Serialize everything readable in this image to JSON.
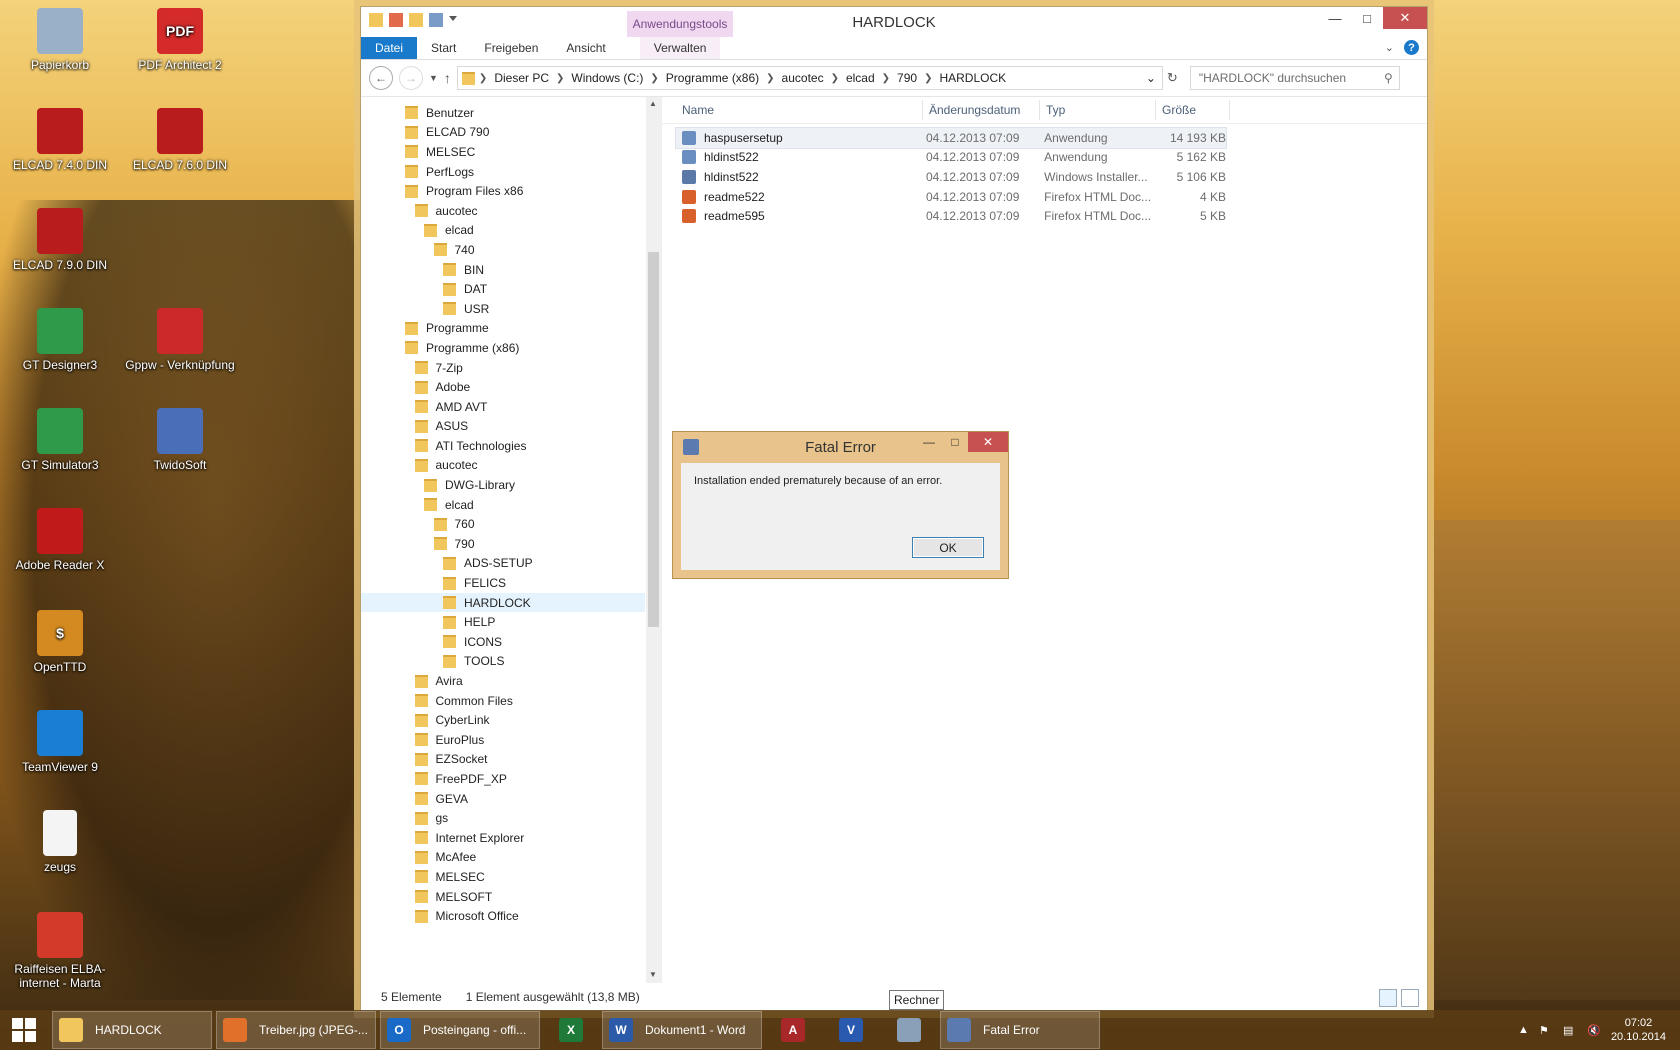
{
  "desktop": {
    "icons": [
      {
        "label": "Papierkorb",
        "icon": "recycle-bin-icon",
        "color": "#9ab0c8"
      },
      {
        "label": "PDF Architect 2",
        "icon": "pdf-icon",
        "color": "#d42a2a",
        "text": "PDF"
      },
      {
        "label": "ELCAD 7.4.0 DIN",
        "icon": "elcad-icon",
        "color": "#b81c1c"
      },
      {
        "label": "ELCAD 7.6.0 DIN",
        "icon": "elcad-icon",
        "color": "#b81c1c"
      },
      {
        "label": "ELCAD 7.9.0 DIN",
        "icon": "elcad-icon",
        "color": "#b81c1c"
      },
      {
        "label": "GT Designer3",
        "icon": "gt-icon",
        "color": "#2f9a4a"
      },
      {
        "label": "Gppw - Verknüpfung",
        "icon": "gppw-icon",
        "color": "#cc2a2a"
      },
      {
        "label": "GT Simulator3",
        "icon": "gt-icon",
        "color": "#2f9a4a"
      },
      {
        "label": "TwidoSoft",
        "icon": "twido-icon",
        "color": "#4a6fb8"
      },
      {
        "label": "Adobe Reader X",
        "icon": "adobe-reader-icon",
        "color": "#c01a1a"
      },
      {
        "label": "OpenTTD",
        "icon": "openttd-icon",
        "color": "#d48a20",
        "text": "$"
      },
      {
        "label": "TeamViewer 9",
        "icon": "teamviewer-icon",
        "color": "#1a7fd4"
      },
      {
        "label": "zeugs",
        "icon": "text-file-icon",
        "color": "#f4f4f4"
      },
      {
        "label": "Raiffeisen ELBA-internet - Marta",
        "icon": "raiffeisen-icon",
        "color": "#d43a2a"
      }
    ]
  },
  "explorer": {
    "title": "HARDLOCK",
    "context_tab": "Anwendungstools",
    "ribbon_tabs": [
      "Datei",
      "Start",
      "Freigeben",
      "Ansicht",
      "Verwalten"
    ],
    "help": "?",
    "breadcrumb": [
      "Dieser PC",
      "Windows (C:)",
      "Programme (x86)",
      "aucotec",
      "elcad",
      "790",
      "HARDLOCK"
    ],
    "search_placeholder": "\"HARDLOCK\" durchsuchen",
    "tree": [
      {
        "label": "Benutzer",
        "indent": 0
      },
      {
        "label": "ELCAD 790",
        "indent": 0
      },
      {
        "label": "MELSEC",
        "indent": 0
      },
      {
        "label": "PerfLogs",
        "indent": 0
      },
      {
        "label": "Program Files x86",
        "indent": 0
      },
      {
        "label": "aucotec",
        "indent": 1
      },
      {
        "label": "elcad",
        "indent": 2
      },
      {
        "label": "740",
        "indent": 3
      },
      {
        "label": "BIN",
        "indent": 4
      },
      {
        "label": "DAT",
        "indent": 4
      },
      {
        "label": "USR",
        "indent": 4
      },
      {
        "label": "Programme",
        "indent": 0
      },
      {
        "label": "Programme (x86)",
        "indent": 0
      },
      {
        "label": "7-Zip",
        "indent": 1
      },
      {
        "label": "Adobe",
        "indent": 1
      },
      {
        "label": "AMD AVT",
        "indent": 1
      },
      {
        "label": "ASUS",
        "indent": 1
      },
      {
        "label": "ATI Technologies",
        "indent": 1
      },
      {
        "label": "aucotec",
        "indent": 1
      },
      {
        "label": "DWG-Library",
        "indent": 2
      },
      {
        "label": "elcad",
        "indent": 2
      },
      {
        "label": "760",
        "indent": 3
      },
      {
        "label": "790",
        "indent": 3
      },
      {
        "label": "ADS-SETUP",
        "indent": 4
      },
      {
        "label": "FELICS",
        "indent": 4
      },
      {
        "label": "HARDLOCK",
        "indent": 4,
        "selected": true
      },
      {
        "label": "HELP",
        "indent": 4
      },
      {
        "label": "ICONS",
        "indent": 4
      },
      {
        "label": "TOOLS",
        "indent": 4
      },
      {
        "label": "Avira",
        "indent": 1
      },
      {
        "label": "Common Files",
        "indent": 1
      },
      {
        "label": "CyberLink",
        "indent": 1
      },
      {
        "label": "EuroPlus",
        "indent": 1
      },
      {
        "label": "EZSocket",
        "indent": 1
      },
      {
        "label": "FreePDF_XP",
        "indent": 1
      },
      {
        "label": "GEVA",
        "indent": 1
      },
      {
        "label": "gs",
        "indent": 1
      },
      {
        "label": "Internet Explorer",
        "indent": 1
      },
      {
        "label": "McAfee",
        "indent": 1
      },
      {
        "label": "MELSEC",
        "indent": 1
      },
      {
        "label": "MELSOFT",
        "indent": 1
      },
      {
        "label": "Microsoft Office",
        "indent": 1
      }
    ],
    "columns": [
      "Name",
      "Änderungsdatum",
      "Typ",
      "Größe"
    ],
    "files": [
      {
        "name": "haspusersetup",
        "date": "04.12.2013 07:09",
        "type": "Anwendung",
        "size": "14 193 KB",
        "icon": "installer-icon",
        "color": "#6a8ec0",
        "selected": true
      },
      {
        "name": "hldinst522",
        "date": "04.12.2013 07:09",
        "type": "Anwendung",
        "size": "5 162 KB",
        "icon": "installer-icon",
        "color": "#6a8ec0"
      },
      {
        "name": "hldinst522",
        "date": "04.12.2013 07:09",
        "type": "Windows Installer...",
        "size": "5 106 KB",
        "icon": "msi-icon",
        "color": "#5a78a8"
      },
      {
        "name": "readme522",
        "date": "04.12.2013 07:09",
        "type": "Firefox HTML Doc...",
        "size": "4 KB",
        "icon": "html-doc-icon",
        "color": "#d8602a"
      },
      {
        "name": "readme595",
        "date": "04.12.2013 07:09",
        "type": "Firefox HTML Doc...",
        "size": "5 KB",
        "icon": "html-doc-icon",
        "color": "#d8602a"
      }
    ],
    "status_count": "5 Elemente",
    "status_selection": "1 Element ausgewählt (13,8 MB)"
  },
  "dialog": {
    "title": "Fatal Error",
    "message": "Installation ended prematurely because of an error.",
    "ok_label": "OK"
  },
  "tooltip": "Rechner",
  "taskbar": {
    "items": [
      {
        "label": "HARDLOCK",
        "icon": "folder-icon",
        "color": "#f1c75d",
        "kind": "app"
      },
      {
        "label": "Treiber.jpg (JPEG-...",
        "icon": "firefox-icon",
        "color": "#e0702a",
        "kind": "app"
      },
      {
        "label": "Posteingang - offi...",
        "icon": "outlook-icon",
        "color": "#1a6ac8",
        "text": "O",
        "kind": "app"
      },
      {
        "label": "",
        "icon": "excel-icon",
        "color": "#1f7a3a",
        "text": "X",
        "kind": "small"
      },
      {
        "label": "Dokument1 - Word",
        "icon": "word-icon",
        "color": "#2b5aa8",
        "text": "W",
        "kind": "app"
      },
      {
        "label": "",
        "icon": "access-icon",
        "color": "#a8282a",
        "text": "A",
        "kind": "small"
      },
      {
        "label": "",
        "icon": "visio-icon",
        "color": "#2a5ab0",
        "text": "V",
        "kind": "small"
      },
      {
        "label": "",
        "icon": "calculator-icon",
        "color": "#8aa0b8",
        "kind": "small"
      },
      {
        "label": "Fatal Error",
        "icon": "installer-icon",
        "color": "#5a7ab0",
        "kind": "app"
      }
    ],
    "time": "07:02",
    "date": "20.10.2014"
  }
}
